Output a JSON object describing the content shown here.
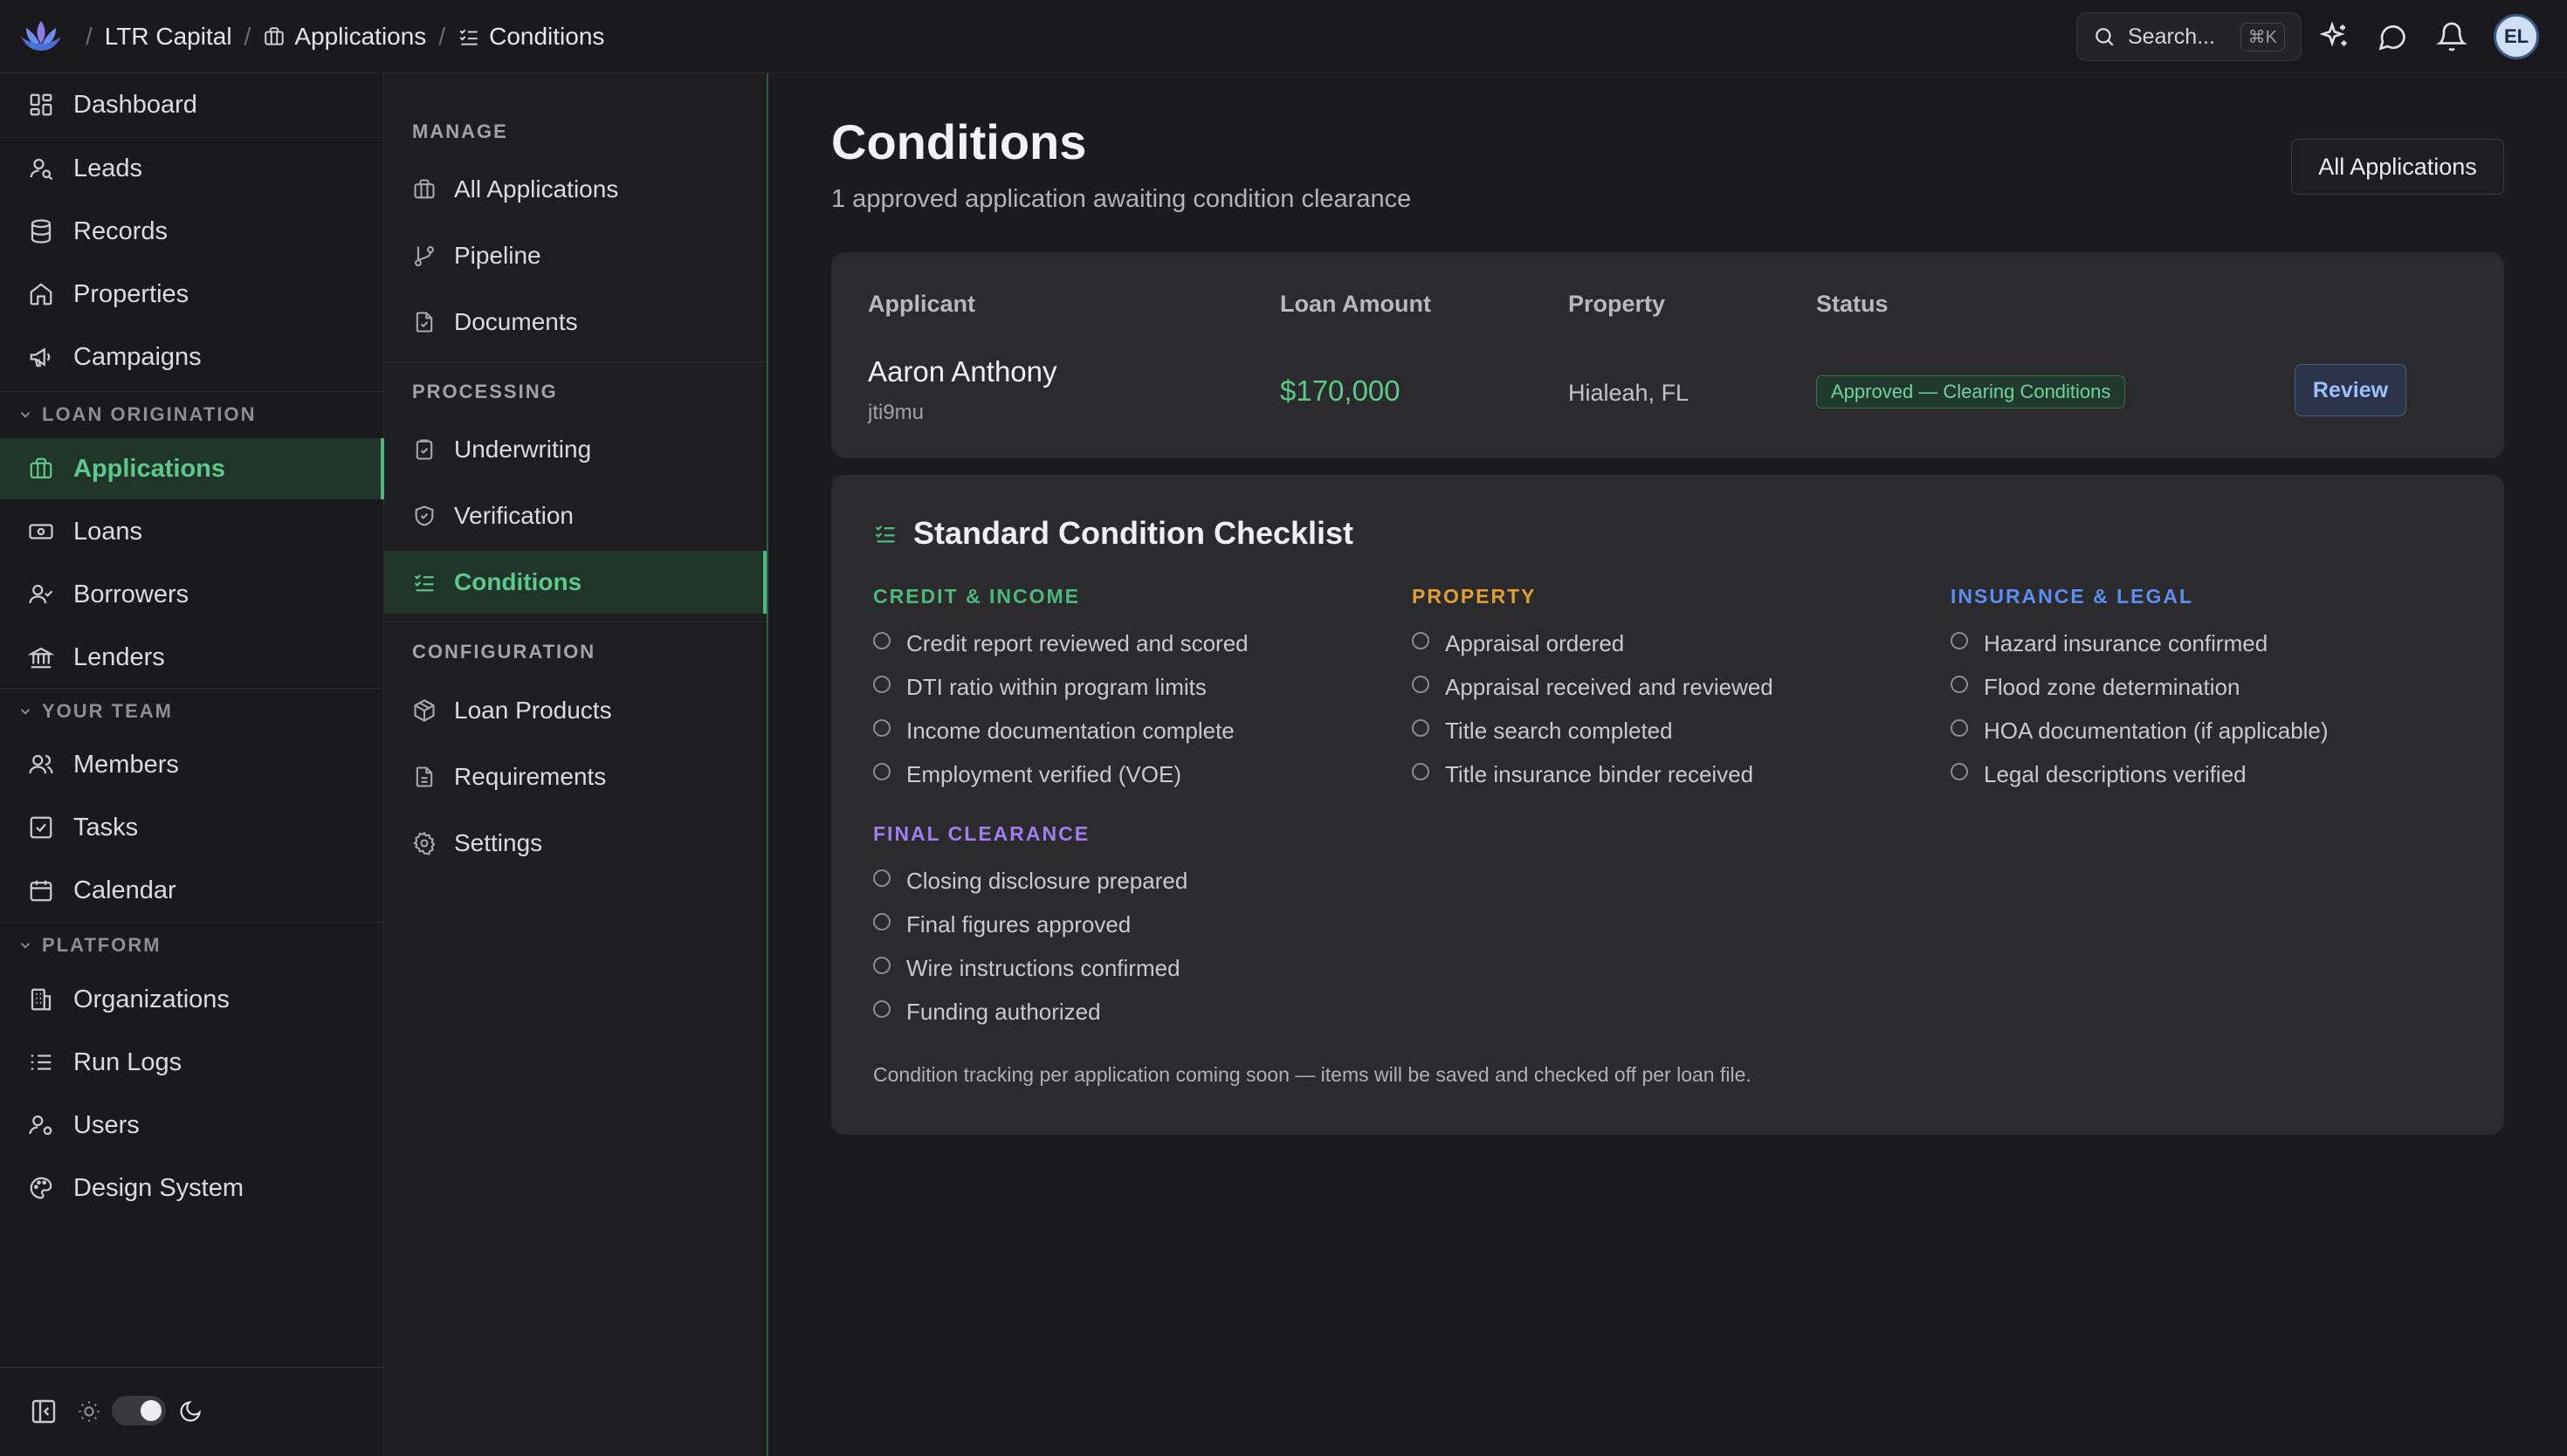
{
  "topbar": {
    "breadcrumbs": [
      "LTR Capital",
      "Applications",
      "Conditions"
    ],
    "search_label": "Search...",
    "search_shortcut": "⌘K",
    "avatar_initials": "EL",
    "icons": [
      "sparkles-icon",
      "chat-icon",
      "bell-icon"
    ]
  },
  "sidebar": {
    "top_items": [
      "Dashboard",
      "Leads",
      "Records",
      "Properties",
      "Campaigns"
    ],
    "sections": [
      {
        "label": "LOAN ORIGINATION",
        "items": [
          "Applications",
          "Loans",
          "Borrowers",
          "Lenders"
        ]
      },
      {
        "label": "YOUR TEAM",
        "items": [
          "Members",
          "Tasks",
          "Calendar"
        ]
      },
      {
        "label": "PLATFORM",
        "items": [
          "Organizations",
          "Run Logs",
          "Users",
          "Design System"
        ]
      }
    ],
    "active_item": "Applications"
  },
  "subnav": {
    "groups": [
      {
        "label": "MANAGE",
        "items": [
          "All Applications",
          "Pipeline",
          "Documents"
        ]
      },
      {
        "label": "PROCESSING",
        "items": [
          "Underwriting",
          "Verification",
          "Conditions"
        ]
      },
      {
        "label": "CONFIGURATION",
        "items": [
          "Loan Products",
          "Requirements",
          "Settings"
        ]
      }
    ],
    "active_item": "Conditions"
  },
  "main": {
    "title": "Conditions",
    "subtitle": "1 approved application awaiting condition clearance",
    "all_applications_button": "All Applications",
    "table": {
      "columns": [
        "Applicant",
        "Loan Amount",
        "Property",
        "Status"
      ],
      "rows": [
        {
          "applicant": "Aaron Anthony",
          "applicant_id": "jti9mu",
          "loan_amount": "$170,000",
          "property": "Hialeah, FL",
          "status": "Approved — Clearing Conditions",
          "action": "Review"
        }
      ]
    },
    "checklist": {
      "title": "Standard Condition Checklist",
      "groups": [
        {
          "title": "CREDIT & INCOME",
          "color": "#4cb87c",
          "items": [
            "Credit report reviewed and scored",
            "DTI ratio within program limits",
            "Income documentation complete",
            "Employment verified (VOE)"
          ]
        },
        {
          "title": "PROPERTY",
          "color": "#e0a030",
          "items": [
            "Appraisal ordered",
            "Appraisal received and reviewed",
            "Title search completed",
            "Title insurance binder received"
          ]
        },
        {
          "title": "INSURANCE & LEGAL",
          "color": "#5b8ef0",
          "items": [
            "Hazard insurance confirmed",
            "Flood zone determination",
            "HOA documentation (if applicable)",
            "Legal descriptions verified"
          ]
        },
        {
          "title": "FINAL CLEARANCE",
          "color": "#a07ef0",
          "items": [
            "Closing disclosure prepared",
            "Final figures approved",
            "Wire instructions confirmed",
            "Funding authorized"
          ]
        }
      ],
      "note": "Condition tracking per application coming soon — items will be saved and checked off per loan file."
    }
  },
  "colors": {
    "accent_green": "#4cb87c",
    "background": "#1c1c1e",
    "card": "#2b2b2e"
  }
}
